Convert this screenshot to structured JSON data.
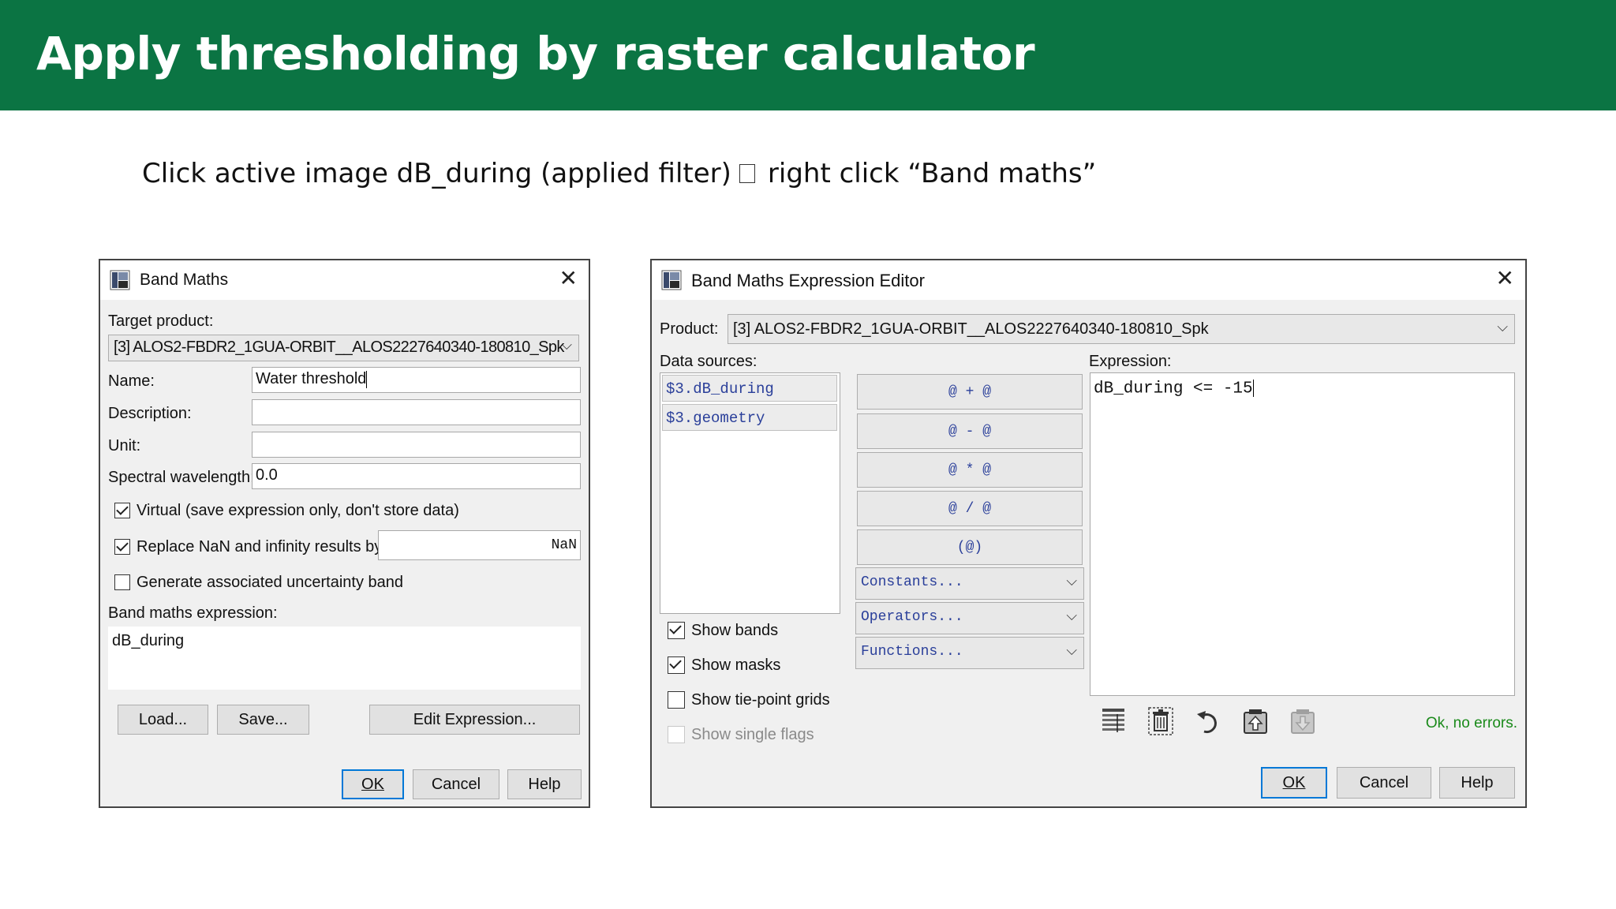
{
  "slide": {
    "title": "Apply thresholding by raster calculator",
    "instruction_left": "Click active image dB_during (applied filter)",
    "instruction_right": "right click “Band maths”"
  },
  "band_maths": {
    "title": "Band Maths",
    "target_product_label": "Target product:",
    "target_product_value": "[3] ALOS2-FBDR2_1GUA-ORBIT__ALOS2227640340-180810_Spk",
    "name_label": "Name:",
    "name_value": "Water threshold",
    "description_label": "Description:",
    "description_value": "",
    "unit_label": "Unit:",
    "unit_value": "",
    "spectral_label": "Spectral wavelength:",
    "spectral_value": "0.0",
    "virtual_label": "Virtual (save expression only, don't store data)",
    "virtual_checked": true,
    "replace_nan_label": "Replace NaN and infinity results by",
    "replace_nan_checked": true,
    "replace_nan_value": "NaN",
    "uncertainty_label": "Generate associated uncertainty band",
    "uncertainty_checked": false,
    "expression_label": "Band maths expression:",
    "expression_value": "dB_during",
    "load_button": "Load...",
    "save_button": "Save...",
    "edit_expression_button": "Edit Expression...",
    "ok_button": "OK",
    "cancel_button": "Cancel",
    "help_button": "Help"
  },
  "expression_editor": {
    "title": "Band Maths Expression Editor",
    "product_label": "Product:",
    "product_value": "[3] ALOS2-FBDR2_1GUA-ORBIT__ALOS2227640340-180810_Spk",
    "data_sources_label": "Data sources:",
    "data_sources": [
      "$3.dB_during",
      "$3.geometry"
    ],
    "operator_buttons": [
      "@ + @",
      "@ - @",
      "@ * @",
      "@ / @",
      "(@)"
    ],
    "constants_label": "Constants...",
    "operators_label": "Operators...",
    "functions_label": "Functions...",
    "show_bands_label": "Show bands",
    "show_bands_checked": true,
    "show_masks_label": "Show masks",
    "show_masks_checked": true,
    "show_tiepoint_label": "Show tie-point grids",
    "show_tiepoint_checked": false,
    "show_flags_label": "Show single flags",
    "show_flags_checked": false,
    "expression_label": "Expression:",
    "expression_value": "dB_during <= -15",
    "status_text": "Ok, no errors.",
    "status_color": "#1a8a1a",
    "toolbar_icons": [
      "table-icon",
      "trash-icon",
      "undo-icon",
      "upload-icon",
      "download-icon"
    ],
    "ok_button": "OK",
    "cancel_button": "Cancel",
    "help_button": "Help"
  },
  "colors": {
    "banner": "#0b7443",
    "mono_text": "#2a3f9a",
    "default_button_border": "#0078d7"
  }
}
